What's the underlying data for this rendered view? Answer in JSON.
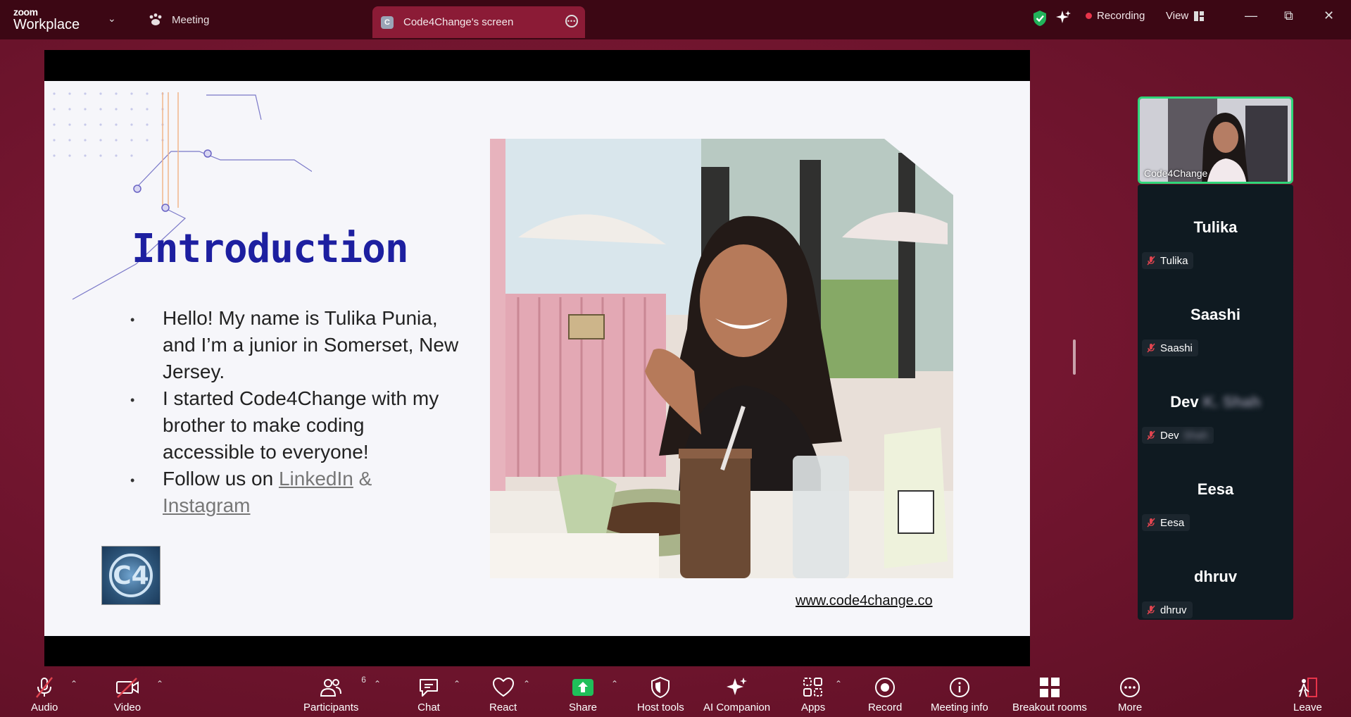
{
  "app": {
    "brand_top": "zoom",
    "brand_bottom": "Workplace"
  },
  "tabs": {
    "meeting": "Meeting",
    "screen": "Code4Change's screen",
    "screen_badge": "C"
  },
  "topright": {
    "recording": "Recording",
    "view": "View"
  },
  "slide": {
    "title": "Introduction",
    "bullets": [
      "Hello! My name is Tulika Punia, and I’m a junior in Somerset, New Jersey.",
      "I started Code4Change with my brother to make coding accessible to everyone!"
    ],
    "follow_prefix": "Follow us on ",
    "linkedin": "LinkedIn",
    "amp": " & ",
    "instagram": "Instagram",
    "url": "www.code4change.co",
    "logo_text": "C4"
  },
  "participants_panel": {
    "self": "Code4Change",
    "tiles": [
      {
        "name": "Tulika",
        "tag": "Tulika"
      },
      {
        "name": "Saashi",
        "tag": "Saashi"
      },
      {
        "name": "Dev",
        "name_blurred": "K. Shah",
        "tag": "Dev",
        "tag_blurred": "Shah"
      },
      {
        "name": "Eesa",
        "tag": "Eesa"
      },
      {
        "name": "dhruv",
        "tag": "dhruv"
      }
    ]
  },
  "toolbar": {
    "audio": "Audio",
    "video": "Video",
    "participants": "Participants",
    "participants_count": "6",
    "chat": "Chat",
    "react": "React",
    "share": "Share",
    "host_tools": "Host tools",
    "ai_companion": "AI Companion",
    "apps": "Apps",
    "record": "Record",
    "meeting_info": "Meeting info",
    "breakout_rooms": "Breakout rooms",
    "more": "More",
    "leave": "Leave"
  },
  "colors": {
    "background": "#7a1832",
    "topbar": "#3c0714",
    "active_tab": "#8b1b36",
    "panel": "#0f1a21",
    "speaker_border": "#2fd67a",
    "share_green": "#1fbf5a",
    "title_blue": "#1d1fa0"
  }
}
